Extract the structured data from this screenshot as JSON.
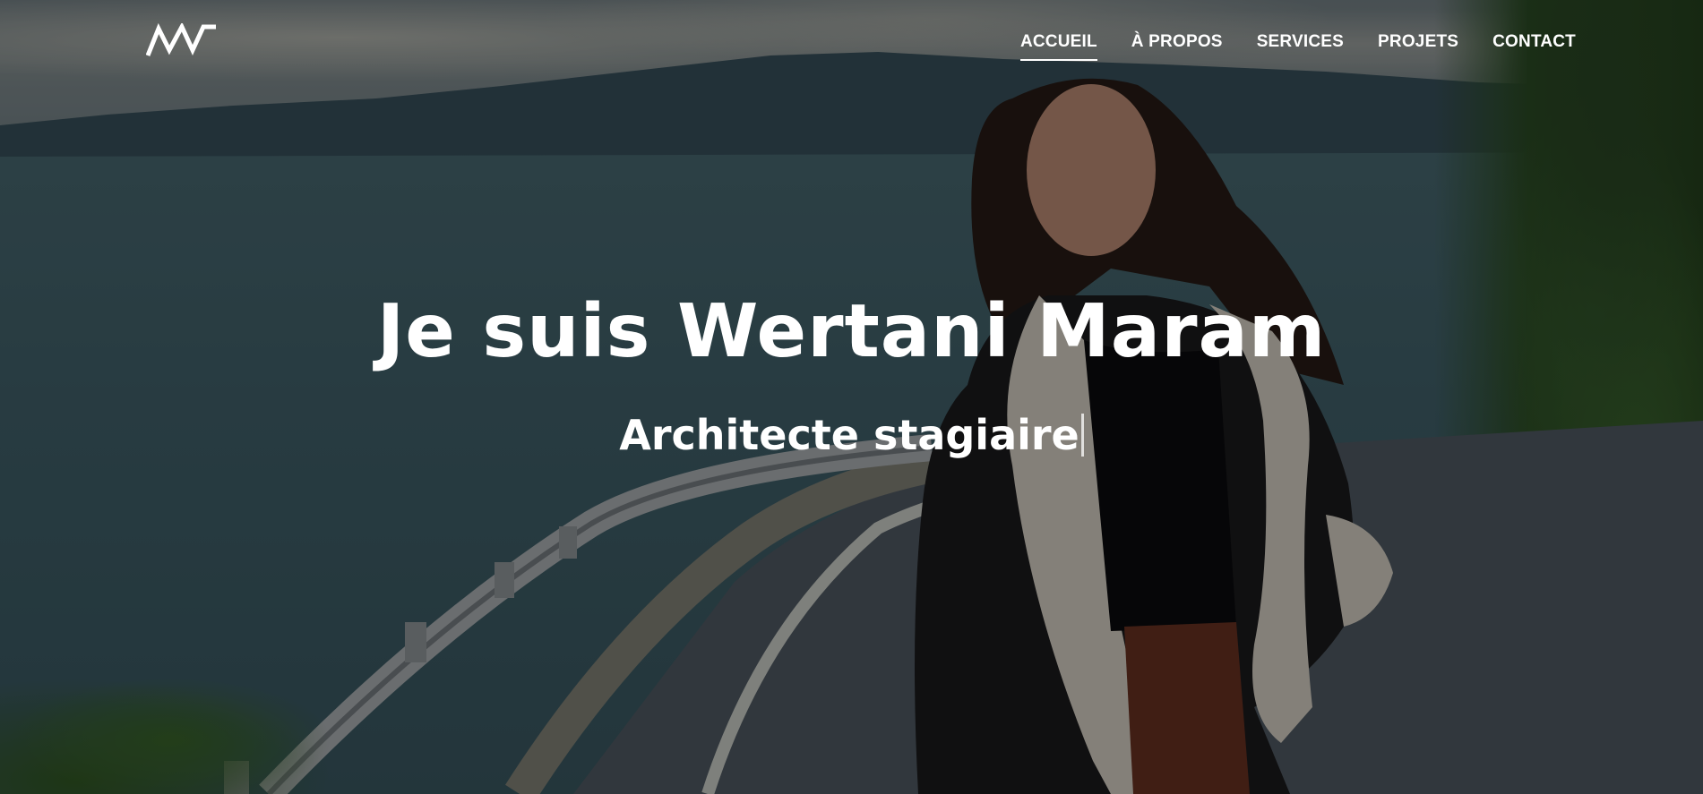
{
  "header": {
    "logo_text": "MW",
    "nav": [
      {
        "label": "ACCUEIL",
        "active": true
      },
      {
        "label": "À PROPOS",
        "active": false
      },
      {
        "label": "SERVICES",
        "active": false
      },
      {
        "label": "PROJETS",
        "active": false
      },
      {
        "label": "CONTACT",
        "active": false
      }
    ]
  },
  "hero": {
    "title": "Je suis Wertani Maram",
    "subtitle": "Architecte stagiaire"
  },
  "colors": {
    "text": "#ffffff",
    "overlay": "rgba(0,0,0,0.42)"
  }
}
